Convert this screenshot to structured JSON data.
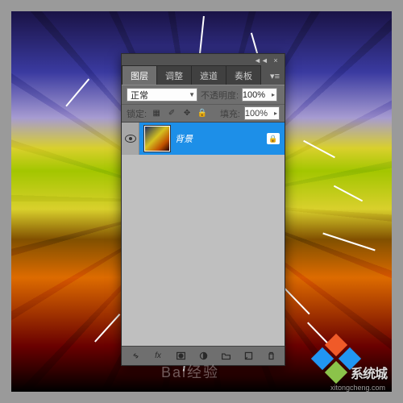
{
  "panel": {
    "tabs": [
      "图层",
      "调整",
      "遮道",
      "奏板"
    ],
    "active_tab": 0,
    "collapse_glyph": "◄◄",
    "close_glyph": "×",
    "flyout_glyph": "▾≡",
    "blend_mode": "正常",
    "opacity_label": "不透明度:",
    "opacity_value": "100%",
    "lock_label": "锁定:",
    "fill_label": "填充:",
    "fill_value": "100%",
    "lock_icons": {
      "transparent": "▦",
      "brush": "✐",
      "move": "✥",
      "all": "🔒"
    },
    "layer": {
      "name": "背景",
      "locked": true
    },
    "footer_icons": {
      "link": "link-icon",
      "fx": "fx",
      "mask": "mask-icon",
      "adjust": "adjust-icon",
      "group": "folder-icon",
      "new": "new-layer-icon",
      "trash": "trash-icon"
    }
  },
  "watermark": {
    "brand": "系统城",
    "sub": "xitongcheng.com",
    "center": "Bai经验"
  }
}
